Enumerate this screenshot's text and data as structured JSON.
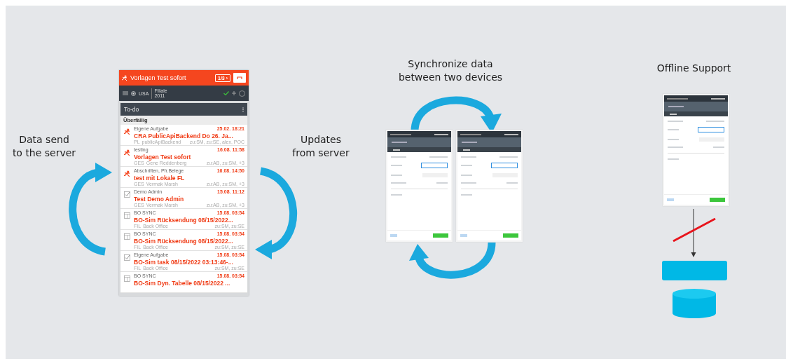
{
  "send_label": [
    "Data send",
    "to the server"
  ],
  "updates_label": [
    "Updates",
    "from server"
  ],
  "sync_label": [
    "Synchronize data",
    "between two devices"
  ],
  "offline_label": "Offline Support",
  "phone": {
    "header_title": "Vorlagen Test sofort",
    "counter": "1/3 ›",
    "store": "USA",
    "branch": [
      "Filiale",
      "2011"
    ],
    "list_title": "To-do",
    "section": "Überfällig",
    "tasks": [
      {
        "kind": "urgent",
        "category": "Eigene Aufgabe",
        "time": "25.02. 18:21",
        "title": "CRA PublicApiBackend Do 26. Ja...",
        "code": "PL",
        "person": "publicApiBackend",
        "assignees": "zu:SM, zu:SE, alex, POC"
      },
      {
        "kind": "urgent",
        "category": "testing",
        "time": "16.08. 11:58",
        "title": "Vorlagen Test sofort",
        "code": "GES",
        "person": "Gene Reddenberg",
        "assignees": "zu:AB, zu:SM, +3"
      },
      {
        "kind": "urgent",
        "category": "Abschriften, Pfr.Belege",
        "time": "16.08. 14:50",
        "title": "test mit Lokale FL",
        "code": "GES",
        "person": "Vermak Marsh",
        "assignees": "zu:AB, zu:SM, +3"
      },
      {
        "kind": "check",
        "category": "Demo Admin",
        "time": "15.08. 11:12",
        "title": "Test Demo Admin",
        "code": "GES",
        "person": "Vermak Marsh",
        "assignees": "zu:AB, zu:SM, +3"
      },
      {
        "kind": "sheet",
        "category": "BO SYNC",
        "time": "15.08. 03:54",
        "title": "BO-Sim Rücksendung 08/15/2022...",
        "code": "FIL",
        "person": "Back Office",
        "assignees": "zu:SM, zu:SE"
      },
      {
        "kind": "sheet",
        "category": "BO SYNC",
        "time": "15.08. 03:54",
        "title": "BO-Sim Rücksendung 08/15/2022...",
        "code": "FIL",
        "person": "Back Office",
        "assignees": "zu:SM, zu:SE"
      },
      {
        "kind": "check",
        "category": "Eigene Aufgabe",
        "time": "15.08. 03:54",
        "title": "BO-Sim task 08/15/2022 03:13:46-...",
        "code": "FIL",
        "person": "Back Office",
        "assignees": "zu:SM, zu:SE"
      },
      {
        "kind": "sheet",
        "category": "BO SYNC",
        "time": "15.08. 03:54",
        "title": "BO-Sim Dyn. Tabelle 08/15/2022 ..."
      }
    ]
  }
}
